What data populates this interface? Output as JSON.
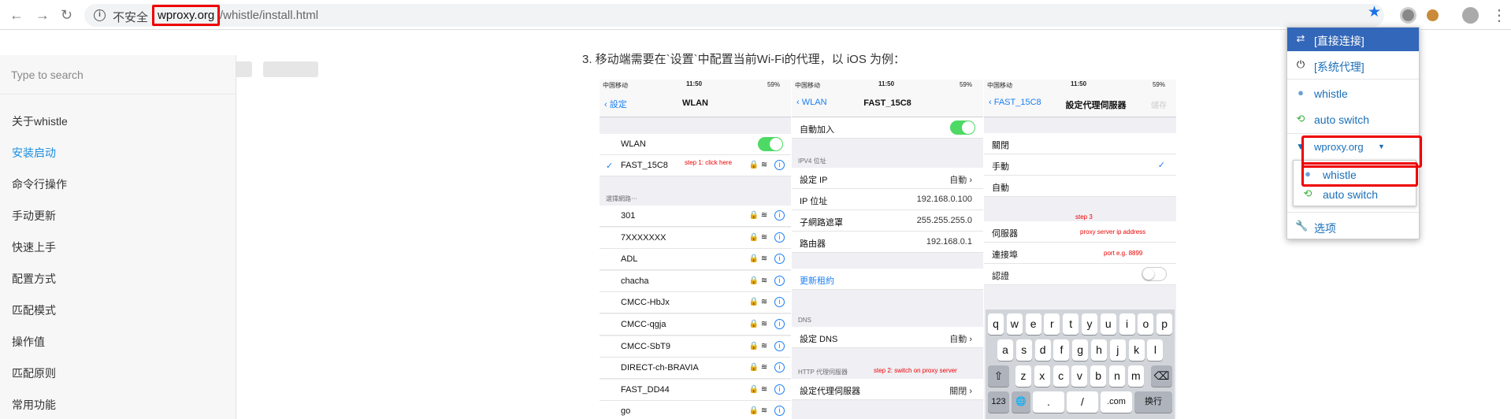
{
  "browser": {
    "security_label": "不安全",
    "url_host": "wproxy.org",
    "url_path": "/whistle/install.html"
  },
  "sidebar": {
    "search_placeholder": "Type to search",
    "items": [
      {
        "label": "关于whistle"
      },
      {
        "label": "安装启动",
        "active": true
      },
      {
        "label": "命令行操作"
      },
      {
        "label": "手动更新"
      },
      {
        "label": "快速上手"
      },
      {
        "label": "配置方式"
      },
      {
        "label": "匹配模式"
      },
      {
        "label": "操作值"
      },
      {
        "label": "匹配原则"
      },
      {
        "label": "常用功能"
      }
    ]
  },
  "content": {
    "step_text": "3. 移动端需要在`设置`中配置当前Wi-Fi的代理，以 iOS 为例："
  },
  "ios": {
    "status": {
      "carrier": "中国移动",
      "time": "11:50",
      "battery": "59%"
    },
    "screen1": {
      "back": "設定",
      "title": "WLAN",
      "wlan_label": "WLAN",
      "connected": "FAST_15C8",
      "step1": "step 1: click here",
      "choose_network": "選擇網路⋯",
      "networks": [
        "301",
        "7XXXXXXX",
        "ADL",
        "chacha",
        "CMCC-HbJx",
        "CMCC-qgja",
        "CMCC-SbT9",
        "DIRECT-ch-BRAVIA",
        "FAST_DD44",
        "go"
      ]
    },
    "screen2": {
      "back": "WLAN",
      "title": "FAST_15C8",
      "auto_join": "自動加入",
      "ipv4_header": "IPV4 位址",
      "rows": [
        {
          "label": "設定 IP",
          "value": "自動"
        },
        {
          "label": "IP 位址",
          "value": "192.168.0.100"
        },
        {
          "label": "子網路遮罩",
          "value": "255.255.255.0"
        },
        {
          "label": "路由器",
          "value": "192.168.0.1"
        }
      ],
      "renew": "更新租約",
      "dns_header": "DNS",
      "dns_label": "設定 DNS",
      "dns_value": "自動",
      "http_header": "HTTP 代理伺服器",
      "step2": "step 2: switch on proxy server",
      "proxy_label": "設定代理伺服器",
      "proxy_value": "關閉"
    },
    "screen3": {
      "back": "FAST_15C8",
      "title": "設定代理伺服器",
      "save": "儲存",
      "options": [
        "關閉",
        "手動",
        "自動"
      ],
      "step3": "step 3",
      "server_label": "伺服器",
      "server_hint": "proxy server ip address",
      "port_label": "連接埠",
      "port_hint": "port e.g. 8899",
      "auth_label": "認證"
    },
    "keyboard": {
      "row1": [
        "q",
        "w",
        "e",
        "r",
        "t",
        "y",
        "u",
        "i",
        "o",
        "p"
      ],
      "row2": [
        "a",
        "s",
        "d",
        "f",
        "g",
        "h",
        "j",
        "k",
        "l"
      ],
      "row3": [
        "z",
        "x",
        "c",
        "v",
        "b",
        "n",
        "m"
      ],
      "num": "123",
      "dot": ".",
      "slash": "/",
      "com": ".com",
      "return": "换行"
    }
  },
  "popup": {
    "direct": "[直接连接]",
    "system": "[系统代理]",
    "whistle": "whistle",
    "auto_switch": "auto switch",
    "wproxy": "wproxy.org",
    "sub_whistle": "whistle",
    "sub_auto_switch": "auto switch",
    "options": "选项"
  },
  "colors": {
    "accent": "#1a73e8",
    "popup_active": "#3367b9",
    "highlight_red": "#e00000",
    "ios_green": "#4cd964"
  }
}
